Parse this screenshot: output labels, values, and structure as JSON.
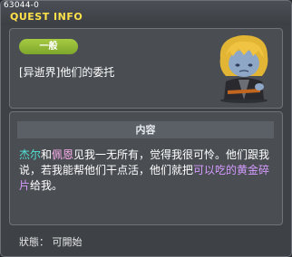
{
  "window": {
    "id": "63044-0",
    "title": "QUEST INFO"
  },
  "quest": {
    "category": "一般",
    "name": "[异逝界]他们的委托"
  },
  "section": {
    "header": "内容"
  },
  "description": {
    "name1": "杰尔",
    "and": "和",
    "name2": "佩恩",
    "line1_rest": "见我一无所有，觉得我很可怜。他们跟我说，若我能帮他们干点活，他们就把",
    "item": "可以吃的黄金碎片",
    "end": "给我。"
  },
  "status": {
    "label": "狀態：",
    "value": "可開始"
  },
  "npc": {
    "icon": "npc-portrait-icon"
  },
  "colors": {
    "title": "#ffe24a",
    "badge": "#8fb935",
    "name1": "#4fe2d4",
    "name2": "#ffb0f0",
    "item": "#d59bff"
  }
}
